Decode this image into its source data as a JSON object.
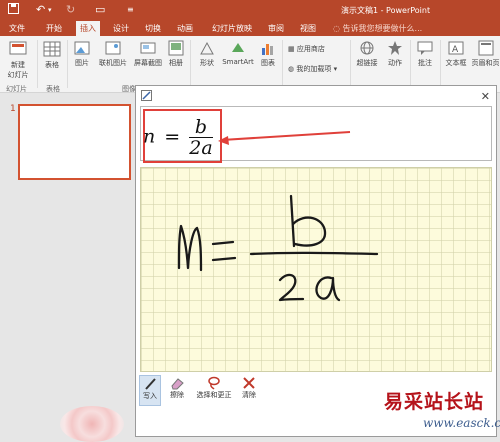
{
  "window": {
    "title": "演示文稿1 - PowerPoint"
  },
  "menu": {
    "tabs": [
      "文件",
      "开始",
      "插入",
      "设计",
      "切换",
      "动画",
      "幻灯片放映",
      "审阅",
      "视图"
    ],
    "active": "插入",
    "tell_me": "告诉我您想要做什么..."
  },
  "ribbon": {
    "new_slide": "新建\n幻灯片",
    "group_slides": "幻灯片",
    "table": "表格",
    "group_tables": "表格",
    "pictures": "图片",
    "online_pictures": "联机图片",
    "screenshot": "屏幕截图",
    "album": "相册",
    "group_images": "图像",
    "shapes": "形状",
    "smartart": "SmartArt",
    "chart": "图表",
    "store": "应用商店",
    "my_addins": "我的加载项",
    "hyperlink": "超链接",
    "action": "动作",
    "comment": "批注",
    "textbox": "文本框",
    "header_footer": "页眉和页"
  },
  "slides": {
    "first_number": "1"
  },
  "math_input": {
    "preview_formula": {
      "lhs": "n",
      "eq": "=",
      "numerator": "b",
      "denominator": "2a"
    },
    "tools": [
      "写入",
      "擦除",
      "选择和更正",
      "清除"
    ],
    "selected_tool": "写入"
  },
  "watermark": {
    "text": "易采站长站",
    "url": "www.easck.com"
  },
  "colors": {
    "accent": "#b7472a",
    "highlight": "#e0403a",
    "writing_bg": "#fdfbdc"
  }
}
